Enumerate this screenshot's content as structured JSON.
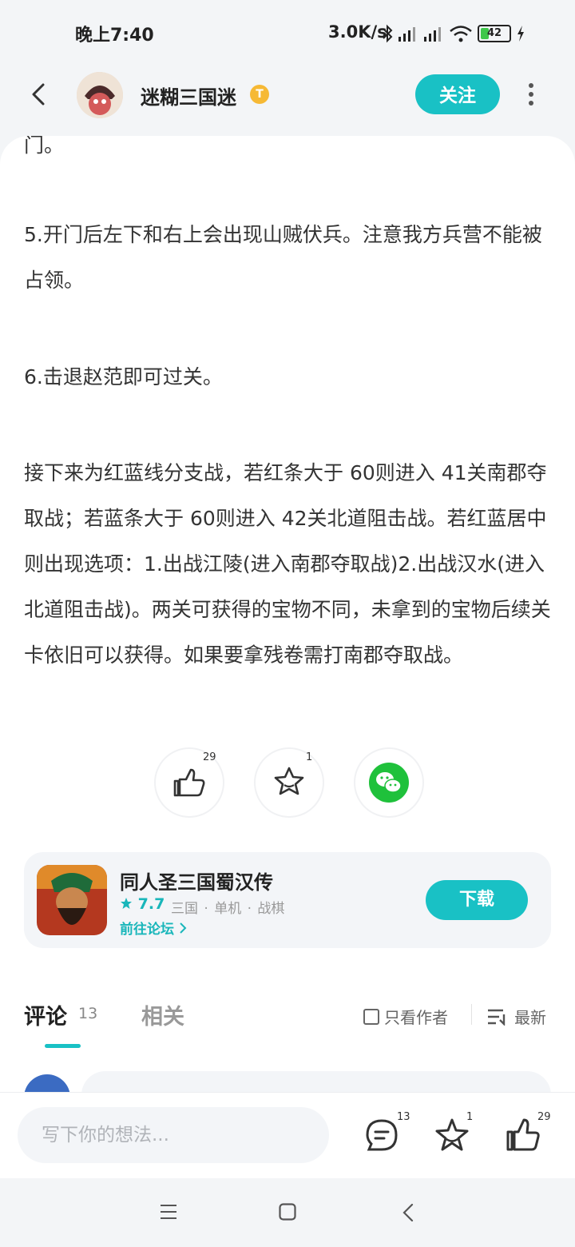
{
  "status_bar": {
    "time": "晚上7:40",
    "network_speed": "3.0K/s",
    "battery": "42"
  },
  "header": {
    "username": "迷糊三国迷",
    "badge": "T",
    "follow_label": "关注"
  },
  "article": {
    "paragraphs": [
      "门。",
      "5.开门后左下和右上会出现山贼伏兵。注意我方兵营不能被占领。",
      "6.击退赵范即可过关。",
      "接下来为红蓝线分支战，若红条大于 60则进入 41关南郡夺取战；若蓝条大于 60则进入 42关北道阻击战。若红蓝居中则出现选项：1.出战江陵(进入南郡夺取战)2.出战汉水(进入北道阻击战)。两关可获得的宝物不同，未拿到的宝物后续关卡依旧可以获得。如果要拿残卷需打南郡夺取战。"
    ],
    "like_count": "29",
    "favorite_count": "1"
  },
  "game_card": {
    "title": "同人圣三国蜀汉传",
    "rating": "7.7",
    "tags": "三国 · 单机 · 战棋",
    "forum_link": "前往论坛",
    "download_label": "下载"
  },
  "tabs": {
    "comments_label": "评论",
    "comments_count": "13",
    "related_label": "相关",
    "author_only_label": "只看作者",
    "sort_label": "最新"
  },
  "bottom_bar": {
    "input_placeholder": "写下你的想法...",
    "comment_count": "13",
    "favorite_count": "1",
    "like_count": "29"
  },
  "colors": {
    "accent": "#19c1c5",
    "wechat": "#1fc13b"
  },
  "icons": [
    "back-icon",
    "more-icon",
    "like-icon",
    "star-icon",
    "wechat-icon",
    "comment-icon",
    "checkbox-icon",
    "sort-icon",
    "nav-menu-icon",
    "nav-home-icon",
    "nav-back-icon"
  ]
}
